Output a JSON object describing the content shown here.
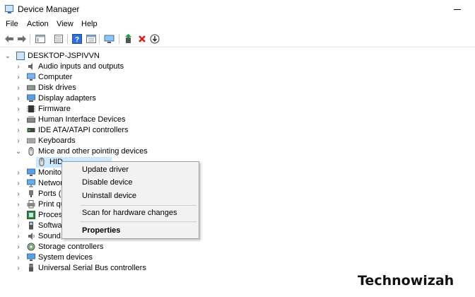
{
  "window": {
    "title": "Device Manager"
  },
  "menu": [
    "File",
    "Action",
    "View",
    "Help"
  ],
  "toolbar": {
    "icons": [
      "back-arrow-icon",
      "forward-arrow-icon",
      "show-hide-console-tree-icon",
      "properties-icon",
      "help-icon",
      "view-icon",
      "monitor-icon",
      "update-driver-icon",
      "uninstall-device-icon",
      "download-icon"
    ]
  },
  "tree": {
    "root": "DESKTOP-JSPIVVN",
    "items": [
      {
        "label": "Audio inputs and outputs",
        "icon": "speaker-icon",
        "expanded": false
      },
      {
        "label": "Computer",
        "icon": "computer-icon",
        "expanded": false
      },
      {
        "label": "Disk drives",
        "icon": "disk-icon",
        "expanded": false
      },
      {
        "label": "Display adapters",
        "icon": "display-adapter-icon",
        "expanded": false
      },
      {
        "label": "Firmware",
        "icon": "firmware-icon",
        "expanded": false
      },
      {
        "label": "Human Interface Devices",
        "icon": "hid-icon",
        "expanded": false
      },
      {
        "label": "IDE ATA/ATAPI controllers",
        "icon": "ide-icon",
        "expanded": false
      },
      {
        "label": "Keyboards",
        "icon": "keyboard-icon",
        "expanded": false
      },
      {
        "label": "Mice and other pointing devices",
        "icon": "mouse-icon",
        "expanded": true
      },
      {
        "label": "HID",
        "icon": "mouse-icon",
        "child": true,
        "selected": true
      },
      {
        "label": "Monito",
        "icon": "monitor-icon",
        "expanded": false
      },
      {
        "label": "Networ",
        "icon": "network-icon",
        "expanded": false
      },
      {
        "label": "Ports (C",
        "icon": "port-icon",
        "expanded": false
      },
      {
        "label": "Print qu",
        "icon": "printer-icon",
        "expanded": false
      },
      {
        "label": "Process",
        "icon": "processor-icon",
        "expanded": false
      },
      {
        "label": "Softwa",
        "icon": "software-icon",
        "expanded": false
      },
      {
        "label": "Sound,",
        "icon": "sound-icon",
        "expanded": false
      },
      {
        "label": "Storage controllers",
        "icon": "storage-icon",
        "expanded": false
      },
      {
        "label": "System devices",
        "icon": "system-icon",
        "expanded": false
      },
      {
        "label": "Universal Serial Bus controllers",
        "icon": "usb-icon",
        "expanded": false
      }
    ]
  },
  "context_menu": {
    "update": "Update driver",
    "disable": "Disable device",
    "uninstall": "Uninstall device",
    "scan": "Scan for hardware changes",
    "properties": "Properties"
  },
  "watermark": "Technowizah"
}
